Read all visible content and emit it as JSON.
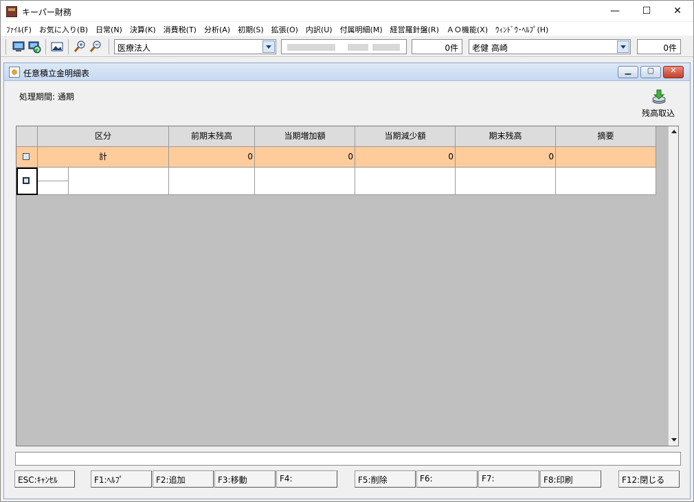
{
  "app": {
    "title": "キーパー財務"
  },
  "window_controls": {
    "minimize": "—",
    "maximize": "☐",
    "close": "✕"
  },
  "menu": [
    "ﾌｧｲﾙ(F)",
    "お気に入り(B)",
    "日常(N)",
    "決算(K)",
    "消費税(T)",
    "分析(A)",
    "初期(S)",
    "拡張(O)",
    "内訳(U)",
    "付属明細(M)",
    "経営羅針盤(R)",
    "ＡＯ機能(X)",
    "ｳｨﾝﾄﾞｳ･ﾍﾙﾌﾟ(H)"
  ],
  "toolbar": {
    "corp_type": "医療法人",
    "count1": "0件",
    "user": "老健 高崎",
    "count2": "0件"
  },
  "child": {
    "title": "任意積立金明細表",
    "period_label": "処理期間: 通期",
    "import_label": "残高取込"
  },
  "grid": {
    "headers": [
      "区分",
      "前期末残高",
      "当期増加額",
      "当期減少額",
      "期末残高",
      "摘要"
    ],
    "total_row": {
      "label": "計",
      "values": [
        "0",
        "0",
        "0",
        "0"
      ],
      "note": ""
    }
  },
  "fkeys": [
    "ESC:ｷｬﾝｾﾙ",
    "F1:ﾍﾙﾌﾟ",
    "F2:追加",
    "F3:移動",
    "F4:",
    "F5:削除",
    "F6:",
    "F7:",
    "F8:印刷",
    "F12:閉じる"
  ],
  "colors": {
    "total_row": "#fecb9b",
    "grid_bg": "#c0c0c0",
    "header_bg": "#dcdcdc"
  }
}
